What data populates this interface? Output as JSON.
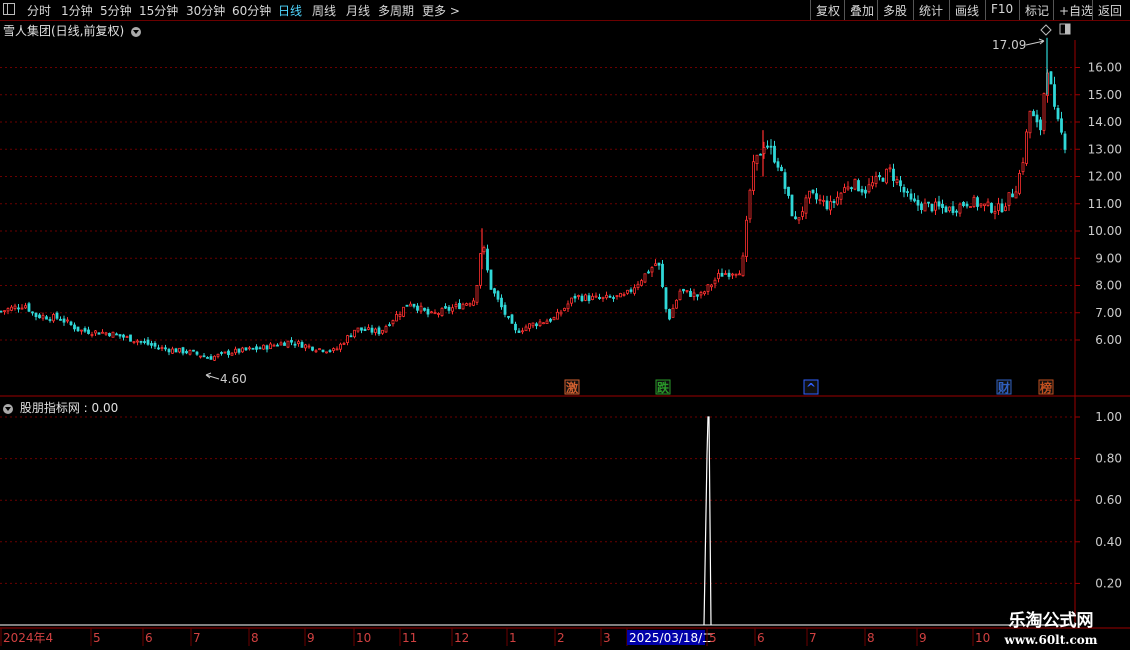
{
  "toolbar": {
    "periods": [
      {
        "label": "分时",
        "active": false
      },
      {
        "label": "1分钟",
        "active": false
      },
      {
        "label": "5分钟",
        "active": false
      },
      {
        "label": "15分钟",
        "active": false
      },
      {
        "label": "30分钟",
        "active": false
      },
      {
        "label": "60分钟",
        "active": false
      },
      {
        "label": "日线",
        "active": true
      },
      {
        "label": "周线",
        "active": false
      },
      {
        "label": "月线",
        "active": false
      },
      {
        "label": "多周期",
        "active": false
      }
    ],
    "more_label": "更多 >",
    "right_buttons": [
      "复权",
      "叠加",
      "多股",
      "统计",
      "画线",
      "F10",
      "标记",
      "+自选",
      "返回"
    ]
  },
  "chart": {
    "title": "雪人集团(日线,前复权)",
    "high_label": "17.09",
    "low_label": "4.60",
    "price_axis": [
      "16.00",
      "15.00",
      "14.00",
      "13.00",
      "12.00",
      "11.00",
      "10.00",
      "9.00",
      "8.00",
      "7.00",
      "6.00"
    ],
    "event_markers": [
      {
        "text": "激",
        "color": "#d06030"
      },
      {
        "text": "跌",
        "color": "#2a9a2a"
      },
      {
        "text": "^",
        "color": "#3060ff"
      },
      {
        "text": "财",
        "color": "#3060c0"
      },
      {
        "text": "榜",
        "color": "#c05020"
      }
    ]
  },
  "indicator": {
    "title": "股朋指标网 : 0.00",
    "axis": [
      "1.00",
      "0.80",
      "0.60",
      "0.40",
      "0.20"
    ]
  },
  "date_axis": {
    "labels": [
      "2024年4",
      "5",
      "6",
      "7",
      "8",
      "9",
      "10",
      "11",
      "12",
      "1",
      "2",
      "3",
      "2025/03/18/二",
      "5",
      "6",
      "7",
      "8",
      "9",
      "10",
      "1"
    ],
    "cursor_label": "2025/03/18/二"
  },
  "watermark": {
    "main": "乐淘公式网",
    "sub": "www.60lt.com"
  },
  "colors": {
    "up": "#ff3030",
    "down": "#30d8d8",
    "accent": "#4fd7ff",
    "grid": "#6b0000"
  }
}
